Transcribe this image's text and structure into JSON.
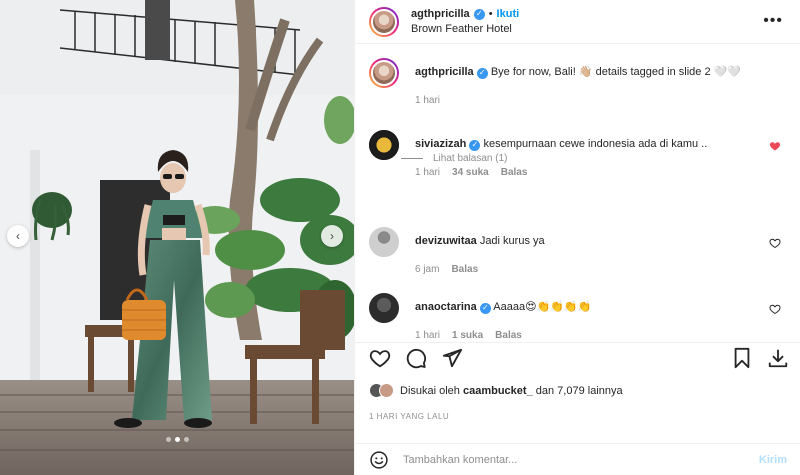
{
  "post": {
    "username": "agthpricilla",
    "follow_label": "Ikuti",
    "separator": "•",
    "location": "Brown Feather Hotel",
    "more_icon": "more-horizontal-icon"
  },
  "photo": {
    "prev_glyph": "‹",
    "next_glyph": "›",
    "slide_count": 3,
    "active_slide": 2
  },
  "caption": {
    "username": "agthpricilla",
    "text": "Bye for now, Bali! 👋🏼 details tagged in slide 2 🤍🤍",
    "time": "1 hari"
  },
  "comments": [
    {
      "username": "siviazizah",
      "verified": true,
      "text": "kesempurnaan cewe indonesia ada di kamu ..",
      "time": "1 hari",
      "likes": "34 suka",
      "reply_label": "Balas",
      "liked": true,
      "view_replies": "Lihat balasan (1)"
    },
    {
      "username": "devizuwitaa",
      "verified": false,
      "text": "Jadi kurus ya",
      "time": "6 jam",
      "reply_label": "Balas",
      "liked": false
    },
    {
      "username": "anaoctarina",
      "verified": true,
      "text": "Aaaaa😍👏👏👏👏",
      "time": "1 hari",
      "likes": "1 suka",
      "reply_label": "Balas",
      "liked": false
    }
  ],
  "likes": {
    "prefix": "Disukai oleh",
    "user": "caambucket_",
    "suffix": "dan 7,079 lainnya"
  },
  "timestamp": "1 HARI YANG LALU",
  "composer": {
    "placeholder": "Tambahkan komentar...",
    "post_label": "Kirim"
  },
  "colors": {
    "accent": "#0095f6",
    "verified": "#3897f0",
    "liked_heart": "#ed4956",
    "muted": "#8e8e8e"
  }
}
